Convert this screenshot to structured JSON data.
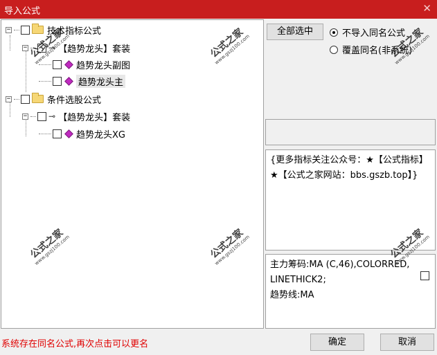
{
  "window": {
    "title": "导入公式",
    "close_glyph": "✕"
  },
  "tree": {
    "nodes": [
      {
        "label": "技术指标公式",
        "expander": "−"
      },
      {
        "label": "【趋势龙头】套装",
        "expander": "−"
      },
      {
        "label": "趋势龙头副图"
      },
      {
        "label": "趋势龙头主"
      },
      {
        "label": "条件选股公式",
        "expander": "−"
      },
      {
        "label": "【趋势龙头】套装",
        "expander": "−"
      },
      {
        "label": "趋势龙头XG"
      }
    ]
  },
  "options": {
    "select_all_label": "全部选中",
    "radio_skip_label": "不导入同名公式",
    "radio_overwrite_label": "覆盖同名(非系统)",
    "selected": "skip"
  },
  "description": "{更多指标关注公众号：★【公式指标】★【公式之家网站：bbs.gszb.top】}",
  "formula_preview": "主力筹码:MA (C,46),COLORRED,LINETHICK2;\n趋势线:MA",
  "status_message": "系统存在同名公式,再次点击可以更名",
  "buttons": {
    "ok": "确定",
    "cancel": "取消"
  },
  "watermark": {
    "name": "公式之家",
    "url": "www.gszj100.com"
  }
}
